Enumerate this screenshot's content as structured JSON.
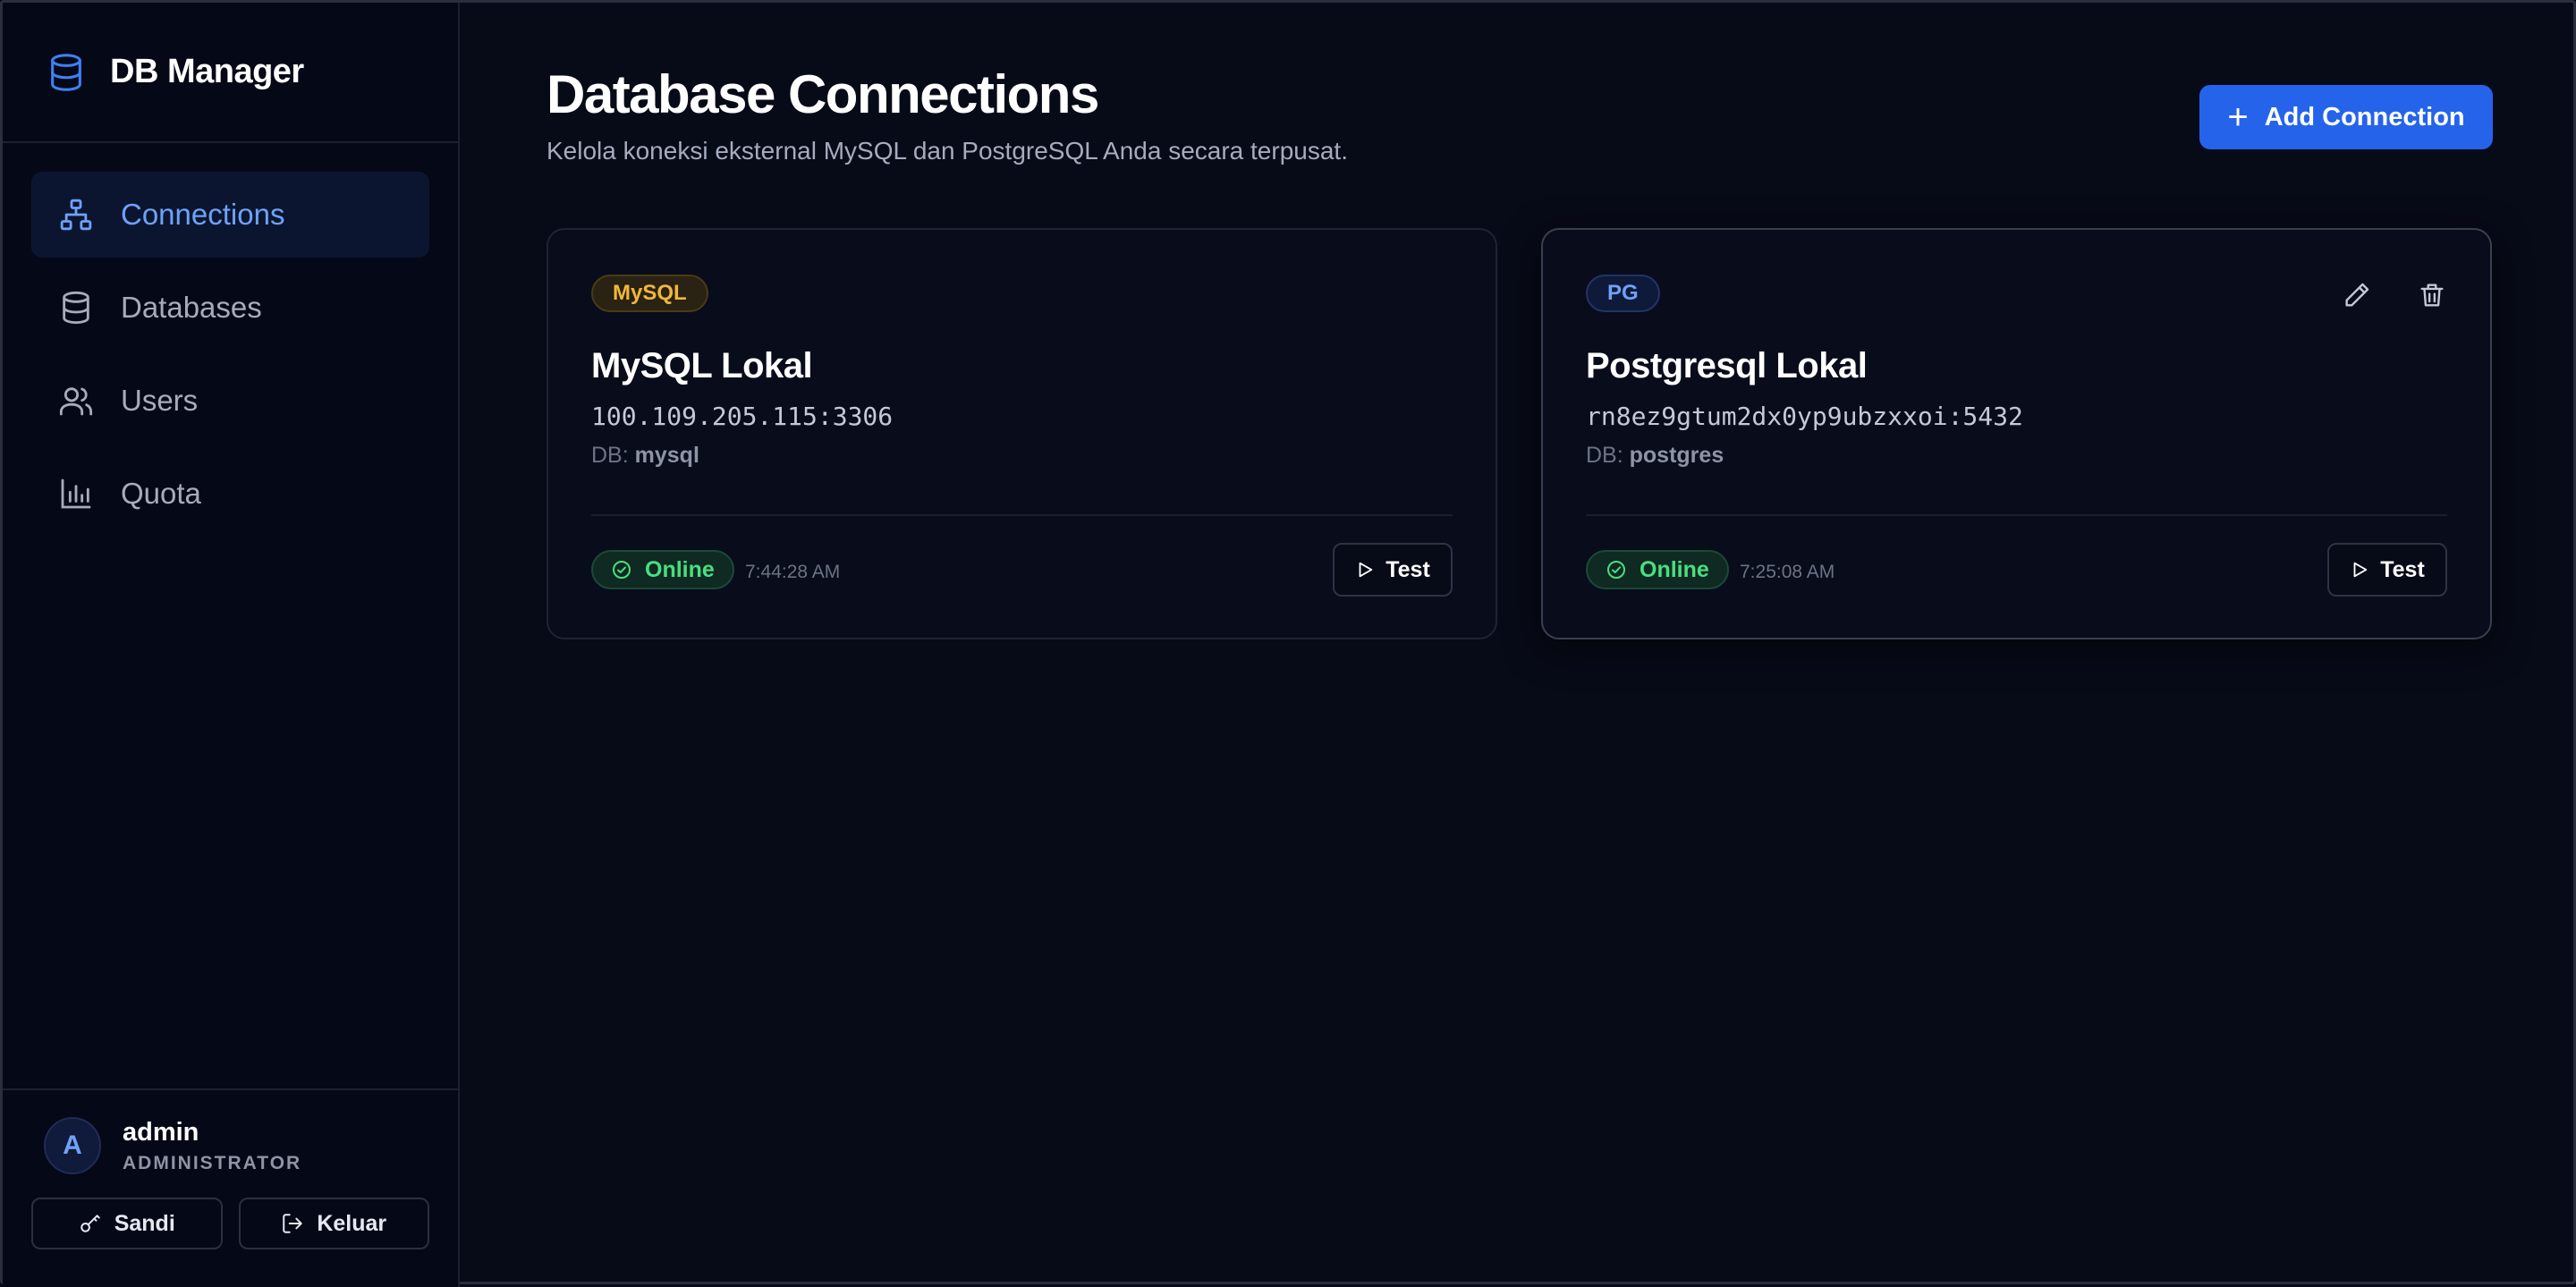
{
  "sidebar": {
    "brand": "DB Manager",
    "items": [
      {
        "label": "Connections",
        "icon": "network-icon",
        "active": true
      },
      {
        "label": "Databases",
        "icon": "database-icon",
        "active": false
      },
      {
        "label": "Users",
        "icon": "users-icon",
        "active": false
      },
      {
        "label": "Quota",
        "icon": "bar-chart-icon",
        "active": false
      }
    ],
    "user": {
      "avatar": "A",
      "name": "admin",
      "role": "ADMINISTRATOR",
      "password_label": "Sandi",
      "logout_label": "Keluar"
    }
  },
  "header": {
    "title": "Database Connections",
    "subtitle": "Kelola koneksi eksternal MySQL dan PostgreSQL Anda secara terpusat.",
    "add_label": "Add Connection"
  },
  "connections": [
    {
      "badge": "MySQL",
      "name": "MySQL Lokal",
      "host": "100.109.205.115:3306",
      "db_prefix": "DB:",
      "db": "mysql",
      "status": "Online",
      "time": "7:44:28 AM",
      "test_label": "Test"
    },
    {
      "badge": "PG",
      "name": "Postgresql Lokal",
      "host": "rn8ez9gtum2dx0yp9ubzxxoi:5432",
      "db_prefix": "DB:",
      "db": "postgres",
      "status": "Online",
      "time": "7:25:08 AM",
      "test_label": "Test"
    }
  ],
  "colors": {
    "accent": "#2563eb",
    "active_nav": "#6ea2f7",
    "online": "#4ade80",
    "mysql_badge": "#f0b73c"
  }
}
